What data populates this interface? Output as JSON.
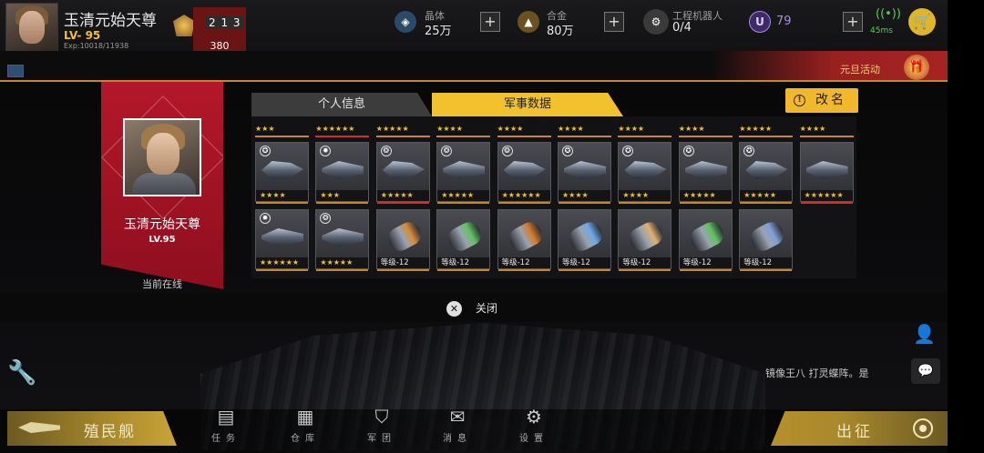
{
  "header": {
    "player_name": "玉清元始天尊",
    "level": "LV- 95",
    "exp": "Exp:10018/11938",
    "exp_progress": 0.84,
    "rank_value": "380"
  },
  "resources": {
    "crystal": {
      "label": "晶体",
      "value": "25万"
    },
    "alloy": {
      "label": "合金",
      "value": "80万"
    },
    "robot": {
      "label": "工程机器人",
      "value": "0/4"
    },
    "premium": {
      "value": "79"
    },
    "ping": "45ms"
  },
  "event": {
    "label": "元旦活动"
  },
  "profile_card": {
    "name": "玉清元始天尊",
    "level": "LV.95",
    "status": "当前在线"
  },
  "tabs": [
    {
      "label": "个人信息",
      "active": false
    },
    {
      "label": "军事数据",
      "active": true
    }
  ],
  "rename_button": "改名",
  "top_ranks": [
    "★★★",
    "★★★★★★",
    "★★★★★",
    "★★★★",
    "★★★★",
    "★★★★",
    "★★★★",
    "★★★★",
    "★★★★★",
    "★★★★"
  ],
  "row1": [
    {
      "stars": "★★★★",
      "badge": "emblem",
      "color": "#d8d8d8"
    },
    {
      "stars": "★★★",
      "badge": "gear",
      "color": "#d8d8d8"
    },
    {
      "stars": "★★★★★",
      "badge": "wings",
      "color": "#d8d8d8"
    },
    {
      "stars": "★★★★★",
      "badge": "wings",
      "color": "#d8d8d8"
    },
    {
      "stars": "★★★★★★",
      "badge": "wings",
      "color": "#d8d8d8"
    },
    {
      "stars": "★★★★",
      "badge": "emblem",
      "color": "#d8d8d8"
    },
    {
      "stars": "★★★★",
      "badge": "emblem",
      "color": "#d8d8d8"
    },
    {
      "stars": "★★★★★",
      "badge": "emblem",
      "color": "#d8d8d8"
    },
    {
      "stars": "★★★★★",
      "badge": "emblem",
      "color": "#d8d8d8"
    },
    {
      "stars": "★★★★★★",
      "badge": "",
      "color": "#d8d8d8"
    }
  ],
  "row2": [
    {
      "text": "★★★★★★",
      "kind": "ship"
    },
    {
      "text": "★★★★★",
      "kind": "ship"
    },
    {
      "text": "等级-12",
      "kind": "module",
      "color": "#d88a3a"
    },
    {
      "text": "等级-12",
      "kind": "module",
      "color": "#5fc45f"
    },
    {
      "text": "等级-12",
      "kind": "module",
      "color": "#d87a2a"
    },
    {
      "text": "等级-12",
      "kind": "module",
      "color": "#6fa8e8"
    },
    {
      "text": "等级-12",
      "kind": "module",
      "color": "#e0b070"
    },
    {
      "text": "等级-12",
      "kind": "module",
      "color": "#5fc45f"
    },
    {
      "text": "等级-12",
      "kind": "module",
      "color": "#7f9fd8"
    }
  ],
  "close_label": "关闭",
  "chat_text": "镜像王八 打灵蝶阵。是",
  "buttons": {
    "colony": "殖民舰",
    "sortie": "出征"
  },
  "nav": [
    "任务",
    "仓库",
    "军团",
    "消息",
    "设置"
  ],
  "colors": {
    "accent": "#f2c12e",
    "card_red": "#b4172a",
    "ping_green": "#4ed34e"
  }
}
